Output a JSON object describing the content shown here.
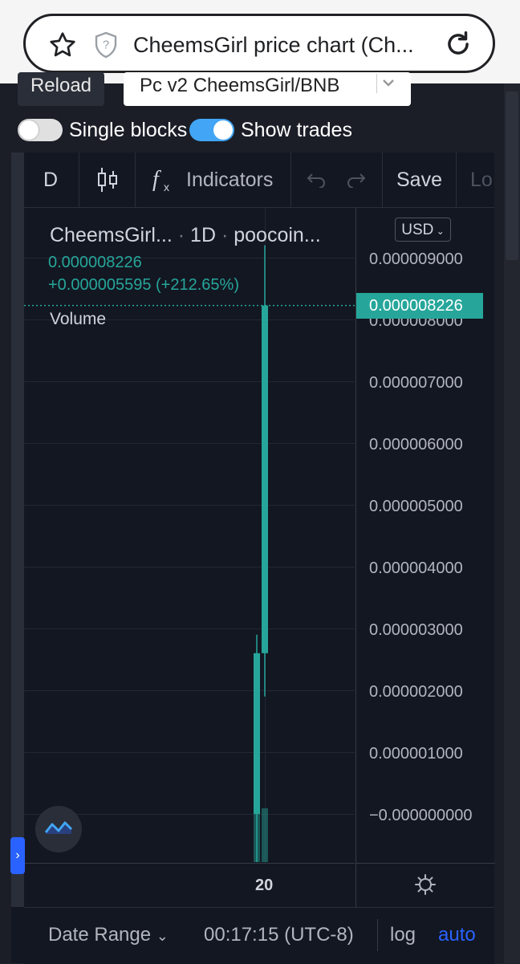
{
  "browser": {
    "title": "CheemsGirl price chart (Ch..."
  },
  "controls": {
    "reload_label": "Reload",
    "pair_value": "Pc v2 CheemsGirl/BNB",
    "single_blocks_label": "Single blocks",
    "single_blocks_on": false,
    "show_trades_label": "Show trades",
    "show_trades_on": true
  },
  "toolbar": {
    "interval": "D",
    "indicators_label": "Indicators",
    "save_label": "Save",
    "load_label": "Lo"
  },
  "legend": {
    "symbol": "CheemsGirl...",
    "interval": "1D",
    "source": "poocoin...",
    "price": "0.000008226",
    "change": "+0.000005595 (+212.65%)",
    "volume_label": "Volume"
  },
  "price_axis": {
    "currency": "USD",
    "labels": [
      "0.000009000",
      "0.000008000",
      "0.000007000",
      "0.000006000",
      "0.000005000",
      "0.000004000",
      "0.000003000",
      "0.000002000",
      "0.000001000",
      "−0.000000000"
    ],
    "current_price": "0.000008226"
  },
  "time_axis": {
    "labels": [
      "20"
    ]
  },
  "bottom_bar": {
    "date_range_label": "Date Range",
    "time": "00:17:15 (UTC-8)",
    "log_label": "log",
    "auto_label": "auto"
  },
  "colors": {
    "up": "#26a69a",
    "accent": "#2962ff",
    "toggle_on": "#42a5f5"
  },
  "chart_data": {
    "type": "candlestick",
    "y_axis_ticks": [
      0,
      1e-06,
      2e-06,
      3e-06,
      4e-06,
      5e-06,
      6e-06,
      7e-06,
      8e-06,
      9e-06
    ],
    "candles": [
      {
        "x": "19",
        "open": 0.0,
        "high": 2.9e-06,
        "low": 0.0,
        "close": 2.6e-06
      },
      {
        "x": "20",
        "open": 2.6e-06,
        "high": 9.2e-06,
        "low": 1.9e-06,
        "close": 8.226e-06
      }
    ],
    "last_price": 8.226e-06
  }
}
